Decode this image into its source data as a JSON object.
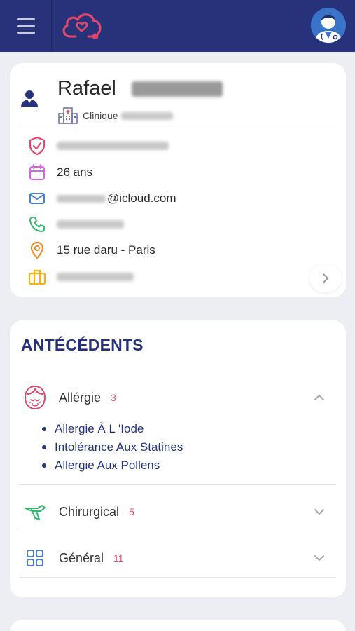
{
  "header": {
    "menu_icon": "hamburger-icon",
    "logo_icon": "cloud-heart-stethoscope-icon",
    "avatar_icon": "doctor-avatar-icon",
    "colors": {
      "bar": "#27327a",
      "logo": "#e0466e",
      "avatar": "#3a74c8"
    }
  },
  "patient": {
    "first_name": "Rafael",
    "clinic_label": "Clinique",
    "age": "26 ans",
    "email_suffix": "@icloud.com",
    "address": "15 rue daru - Paris",
    "icons": {
      "person": "person-icon",
      "clinic": "hospital-building-icon",
      "id": "shield-check-icon",
      "age": "calendar-icon",
      "email": "mail-icon",
      "phone": "phone-icon",
      "address": "map-pin-icon",
      "job": "briefcase-icon",
      "more": "chevron-right-icon"
    }
  },
  "antecedents": {
    "title": "ANTÉCÉDENTS",
    "categories": [
      {
        "label": "Allérgie",
        "count": "3",
        "icon": "allergy-face-icon",
        "expanded": true,
        "items": [
          "Allergie À L 'Iode",
          "Intolérance Aux Statines",
          "Allergie Aux Pollens"
        ]
      },
      {
        "label": "Chirurgical",
        "count": "5",
        "icon": "scalpel-icon",
        "expanded": false,
        "items": []
      },
      {
        "label": "Général",
        "count": "11",
        "icon": "grid-icon",
        "expanded": false,
        "items": []
      }
    ],
    "colors": {
      "title": "#27327a",
      "count": "#e0466e"
    }
  }
}
